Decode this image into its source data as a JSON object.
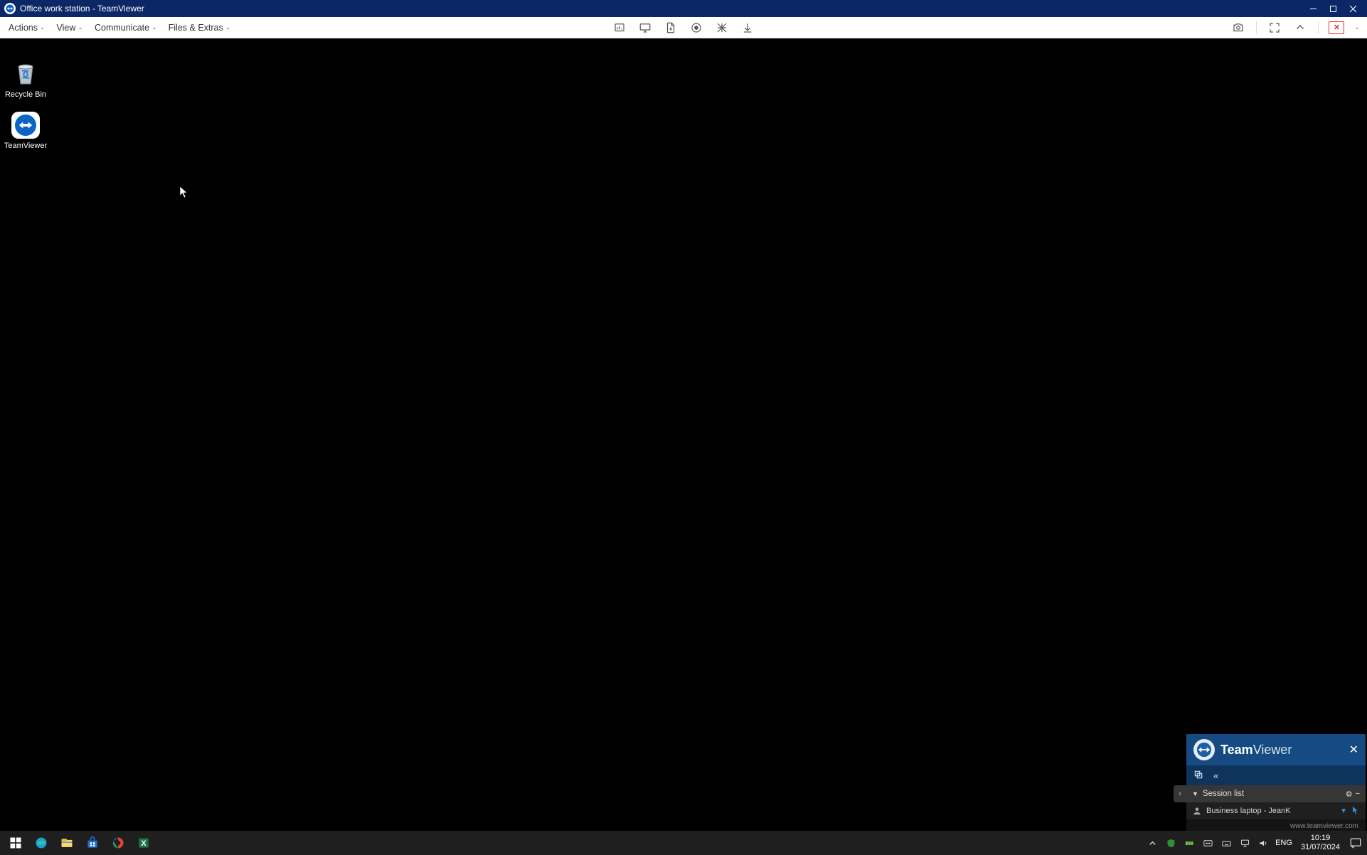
{
  "titlebar": {
    "title": "Office work station - TeamViewer"
  },
  "toolbar": {
    "menus": {
      "actions": "Actions",
      "view": "View",
      "communicate": "Communicate",
      "files_extras": "Files & Extras"
    }
  },
  "desktop": {
    "icons": {
      "recycle_bin": "Recycle Bin",
      "teamviewer": "TeamViewer"
    }
  },
  "tv_panel": {
    "brand_bold": "Team",
    "brand_light": "Viewer",
    "session_list_label": "Session list",
    "session_row": "Business laptop - JeanK",
    "footer_url": "www.teamviewer.com"
  },
  "taskbar": {
    "lang": "ENG",
    "time": "10:19",
    "date": "31/07/2024"
  },
  "icons": {
    "dashboard": "dashboard-icon",
    "monitor": "monitor-icon",
    "file_transfer": "file-transfer-icon",
    "record": "record-icon",
    "annotate": "annotate-icon",
    "download": "download-icon",
    "screenshot": "screenshot-icon",
    "fullscreen": "fullscreen-icon",
    "minimize_panel": "minimize-panel-icon",
    "close_session": "close-session-icon"
  }
}
